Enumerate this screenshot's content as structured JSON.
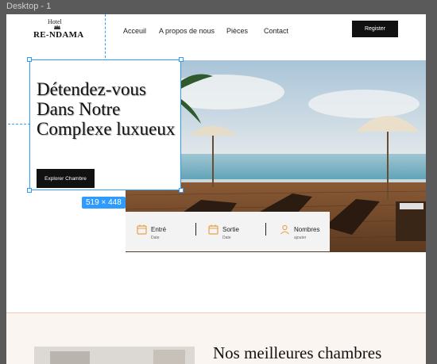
{
  "frame_label": "Desktop - 1",
  "logo": {
    "top": "Hotel",
    "main": "RE-NDAMA"
  },
  "nav": [
    "Acceuil",
    "A propos de nous",
    "Pièces",
    "Contact"
  ],
  "register_label": "Register",
  "hero": {
    "title": "Détendez-vous Dans Notre Complexe luxueux",
    "button_label": "Explorer Chambre"
  },
  "selection": {
    "dimensions": "519 × 448",
    "color": "#2f9bff"
  },
  "booking": {
    "items": [
      {
        "label": "Entré",
        "sub": "Date",
        "icon": "calendar-icon"
      },
      {
        "label": "Sortie",
        "sub": "Date",
        "icon": "calendar-icon"
      },
      {
        "label": "Nombres",
        "sub": "ajouter",
        "icon": "user-icon"
      }
    ],
    "accent": "#e8a24a"
  },
  "section": {
    "title": "Nos meilleures chambres"
  }
}
